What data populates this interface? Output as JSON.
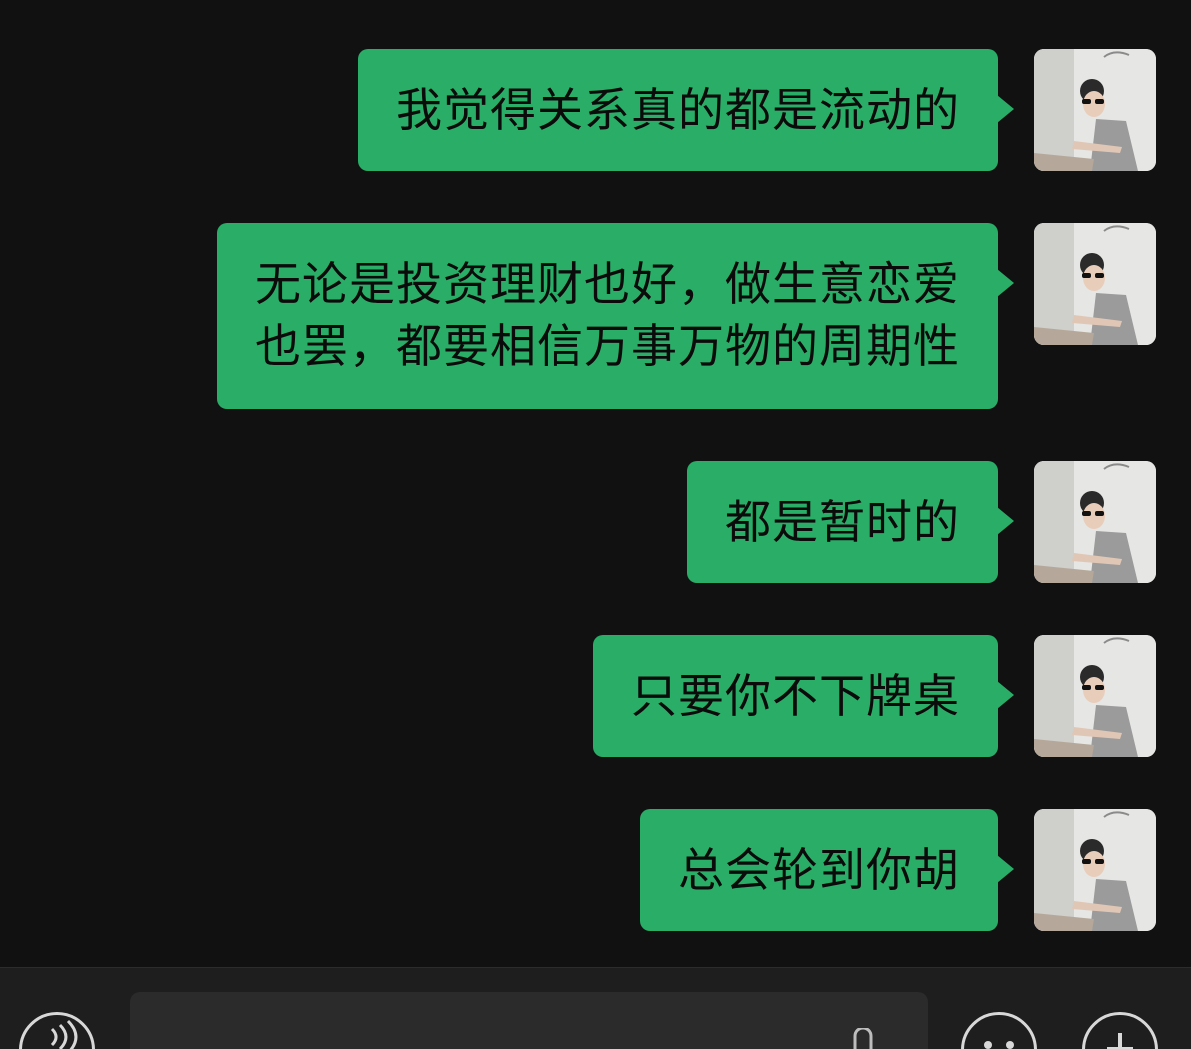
{
  "messages": [
    {
      "lines": [
        "我觉得关系真的都是流动的"
      ]
    },
    {
      "lines": [
        "无论是投资理财也好，做生意恋爱",
        "也罢，都要相信万事万物的周期性"
      ]
    },
    {
      "lines": [
        "都是暂时的"
      ]
    },
    {
      "lines": [
        "只要你不下牌桌"
      ]
    },
    {
      "lines": [
        "总会轮到你胡"
      ]
    }
  ],
  "input_bar": {
    "voice_icon": "voice-icon",
    "emoji_icon": "emoji-icon",
    "plus_icon": "plus-icon",
    "mic_icon": "mic-icon"
  },
  "colors": {
    "background": "#111111",
    "bubble": "#2aae67",
    "input_bar": "#1e1e1e"
  }
}
